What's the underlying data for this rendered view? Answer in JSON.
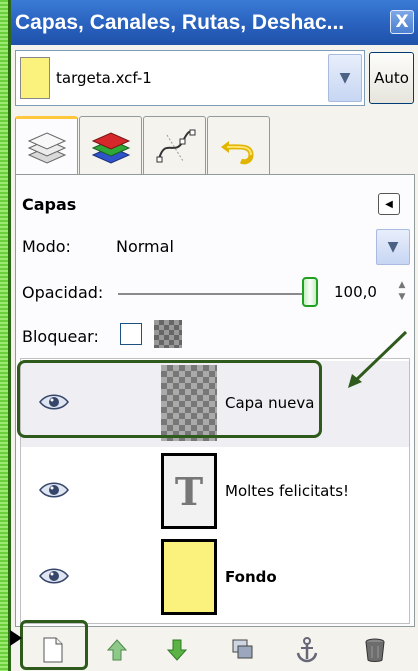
{
  "window": {
    "title": "Capas, Canales, Rutas, Deshac...",
    "close_glyph": "X"
  },
  "image_selector": {
    "value": "targeta.xcf-1",
    "auto_label": "Auto"
  },
  "tabs": [
    {
      "name": "layers",
      "icon": "layers-icon",
      "active": true
    },
    {
      "name": "channels",
      "icon": "channels-icon",
      "active": false
    },
    {
      "name": "paths",
      "icon": "paths-icon",
      "active": false
    },
    {
      "name": "undo",
      "icon": "undo-icon",
      "active": false
    }
  ],
  "layers_panel": {
    "title": "Capas",
    "mode_label": "Modo:",
    "mode_value": "Normal",
    "opacity_label": "Opacidad:",
    "opacity_value": "100,0",
    "lock_label": "Bloquear:"
  },
  "layers": [
    {
      "name": "Capa nueva",
      "visible": true,
      "thumbnail": "transparent-checker",
      "selected": true
    },
    {
      "name": "Moltes felicitats!",
      "visible": true,
      "thumbnail": "text-layer",
      "thumb_letter": "T",
      "selected": false
    },
    {
      "name": "Fondo",
      "visible": true,
      "thumbnail": "yellow-fill",
      "selected": false
    }
  ],
  "bottom_toolbar": [
    {
      "name": "new-layer",
      "icon": "new-document-icon"
    },
    {
      "name": "raise-layer",
      "icon": "arrow-up-icon"
    },
    {
      "name": "lower-layer",
      "icon": "arrow-down-icon"
    },
    {
      "name": "duplicate-layer",
      "icon": "duplicate-icon"
    },
    {
      "name": "anchor-layer",
      "icon": "anchor-icon"
    },
    {
      "name": "delete-layer",
      "icon": "trash-icon"
    }
  ],
  "colors": {
    "title_bar": "#2a63c0",
    "highlight_border": "#2e5a1c",
    "thumbnail_yellow": "#fbf27e",
    "slider_handle": "#21a121"
  }
}
